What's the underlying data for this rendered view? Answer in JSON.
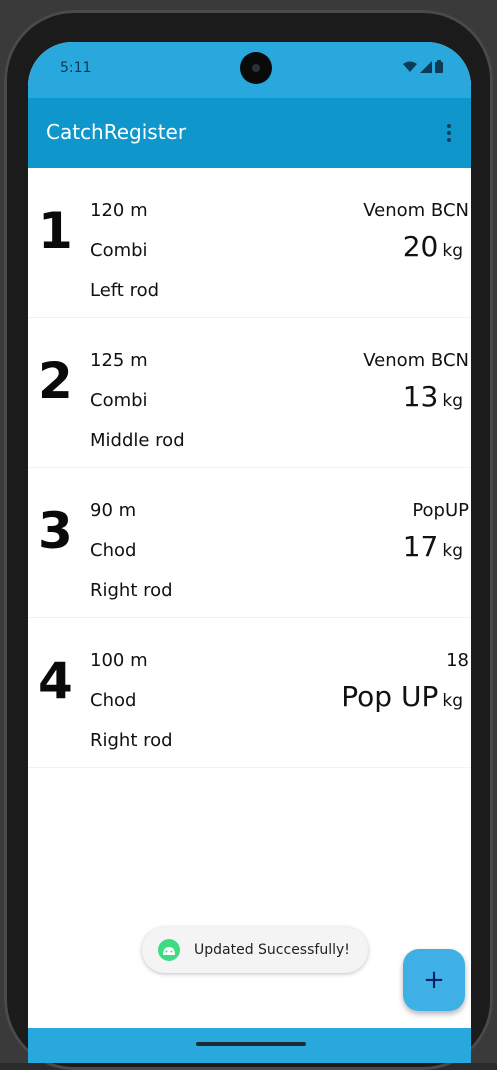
{
  "status_bar": {
    "time": "5:11",
    "icons": [
      "wifi-icon",
      "signal-icon",
      "battery-icon"
    ]
  },
  "app_bar": {
    "title": "CatchRegister",
    "menu_icon": "more-vert-icon"
  },
  "rows": [
    {
      "number": "1",
      "line1": "120 m",
      "line2": "Combi",
      "line3": "Left rod",
      "right_top": "Venom BCN",
      "weight": "20",
      "unit": "kg"
    },
    {
      "number": "2",
      "line1": "125 m",
      "line2": "Combi",
      "line3": "Middle rod",
      "right_top": "Venom BCN",
      "weight": "13",
      "unit": "kg"
    },
    {
      "number": "3",
      "line1": "90 m",
      "line2": "Chod",
      "line3": "Right rod",
      "right_top": "PopUP",
      "weight": "17",
      "unit": "kg"
    },
    {
      "number": "4",
      "line1": "100 m",
      "line2": "Chod",
      "line3": "Right rod",
      "right_top": "18",
      "weight": "Pop UP",
      "unit": "kg"
    }
  ],
  "toast": {
    "text": "Updated Successfully!",
    "icon": "android-icon"
  },
  "fab": {
    "label": "+",
    "icon": "add-icon"
  },
  "colors": {
    "status_bar": "#28a8dc",
    "app_bar": "#0f97cc",
    "fab": "#3eb0e6"
  }
}
